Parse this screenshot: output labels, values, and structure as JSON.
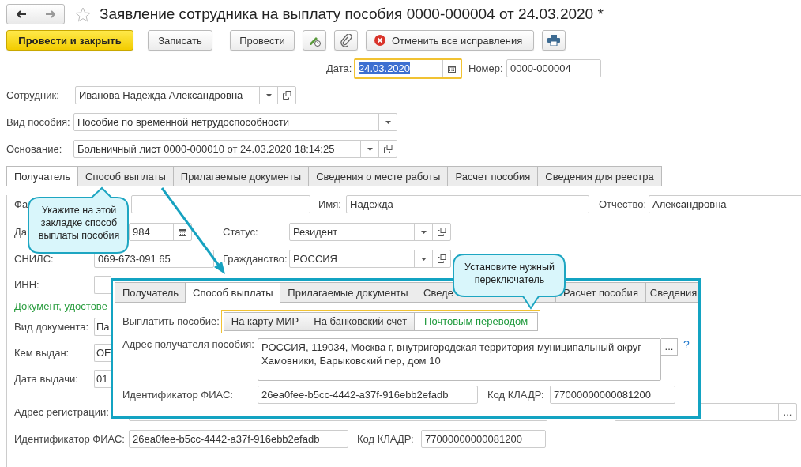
{
  "window": {
    "title": "Заявление сотрудника на выплату пособия 0000-000004 от 24.03.2020 *"
  },
  "toolbar": {
    "post_close": "Провести и закрыть",
    "save": "Записать",
    "post": "Провести",
    "cancel_fixes": "Отменить все исправления"
  },
  "header": {
    "date_label": "Дата:",
    "date": "24.03.2020",
    "date_selected": true,
    "number_label": "Номер:",
    "number": "0000-000004",
    "employee_label": "Сотрудник:",
    "employee": "Иванова Надежда Александровна",
    "benefit_label": "Вид пособия:",
    "benefit": "Пособие по временной нетрудоспособности",
    "basis_label": "Основание:",
    "basis": "Больничный лист 0000-000010 от 24.03.2020 18:14:25"
  },
  "tabs": [
    {
      "label": "Получатель",
      "selected": true
    },
    {
      "label": "Способ выплаты",
      "selected": false
    },
    {
      "label": "Прилагаемые документы",
      "selected": false
    },
    {
      "label": "Сведения о месте работы",
      "selected": false
    },
    {
      "label": "Расчет пособия",
      "selected": false
    },
    {
      "label": "Сведения для реестра",
      "selected": false
    }
  ],
  "recipient": {
    "surname_label": "Фа",
    "first_name_label": "Имя:",
    "first_name": "Надежда",
    "patronymic_label": "Отчество:",
    "patronymic": "Александровна",
    "birth_label": "Да",
    "birth": "984",
    "status_label": "Статус:",
    "status": "Резидент",
    "snils_label": "СНИЛС:",
    "snils": "069-673-091 65",
    "citizenship_label": "Гражданство:",
    "citizenship": "РОССИЯ",
    "inn_label": "ИНН:",
    "doc_section": "Документ, удостове",
    "doc_type_label": "Вид документа:",
    "doc_type": "Па",
    "issued_by_label": "Кем выдан:",
    "issued_by": "ОЕ",
    "issue_date_label": "Дата выдачи:",
    "issue_date": "01",
    "address_label": "Адрес регистрации:",
    "phone_button": "...",
    "fias_label": "Идентификатор ФИАС:",
    "fias": "26ea0fee-b5cc-4442-a37f-916ebb2efadb",
    "kladr_label": "Код КЛАДР:",
    "kladr": "77000000000081200"
  },
  "inset": {
    "tabs": [
      {
        "label": "Получатель",
        "selected": false
      },
      {
        "label": "Способ выплаты",
        "selected": true
      },
      {
        "label": "Прилагаемые документы",
        "selected": false
      },
      {
        "label": "Сведе",
        "selected": false
      },
      {
        "label": "Расчет пособия",
        "selected": false
      },
      {
        "label": "Сведения",
        "selected": false
      }
    ],
    "pay_label": "Выплатить пособие:",
    "pay_options": [
      {
        "label": "На карту МИР",
        "selected": false
      },
      {
        "label": "На банковский счет",
        "selected": false
      },
      {
        "label": "Почтовым переводом",
        "selected": true
      }
    ],
    "address_label": "Адрес получателя пособия:",
    "address": "РОССИЯ, 119034, Москва г, внутригородская территория муниципальный округ Хамовники, Барыковский пер, дом 10",
    "address_button": "...",
    "help": "?",
    "fias_label": "Идентификатор ФИАС:",
    "fias": "26ea0fee-b5cc-4442-a37f-916ebb2efadb",
    "kladr_label": "Код КЛАДР:",
    "kladr": "77000000000081200"
  },
  "callouts": [
    {
      "text": "Укажите на этой закладке способ выплаты пособия"
    },
    {
      "text": "Установите нужный переключатель"
    }
  ]
}
